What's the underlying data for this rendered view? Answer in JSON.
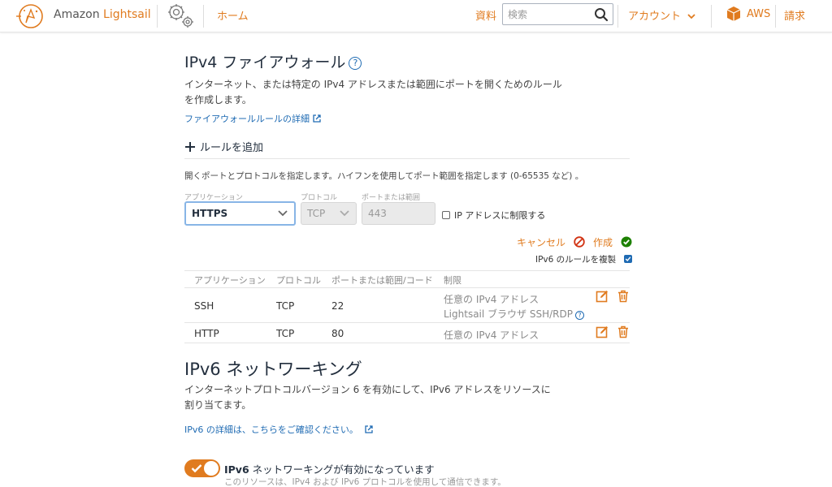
{
  "header": {
    "brand_prefix": "Amazon",
    "brand_name": "Lightsail",
    "home": "ホーム",
    "docs": "資料",
    "search_placeholder": "検索",
    "account": "アカウント",
    "aws": "AWS",
    "billing": "請求"
  },
  "ipv4": {
    "title": "IPv4 ファイアウォール",
    "help": "?",
    "description": "インターネット、または特定の IPv4 アドレスまたは範囲にポートを開くためのルールを作成します。",
    "learn_more": "ファイアウォールルールの詳細",
    "add_rule": "ルールを追加",
    "instructions": "開くポートとプロトコルを指定します。ハイフンを使用してポート範囲を指定します (0-65535 など) 。",
    "form": {
      "application_label": "アプリケーション",
      "application_value": "HTTPS",
      "protocol_label": "プロトコル",
      "protocol_value": "TCP",
      "port_label": "ポートまたは範囲",
      "port_value": "443",
      "restrict_ip": "IP アドレスに制限する",
      "cancel": "キャンセル",
      "create": "作成",
      "duplicate_ipv6": "IPv6 のルールを複製"
    },
    "table": {
      "headers": [
        "アプリケーション",
        "プロトコル",
        "ポートまたは範囲/コード",
        "制限"
      ],
      "rows": [
        {
          "app": "SSH",
          "protocol": "TCP",
          "port": "22",
          "restriction": "任意の IPv4 アドレス",
          "restriction2": "Lightsail ブラウザ SSH/RDP"
        },
        {
          "app": "HTTP",
          "protocol": "TCP",
          "port": "80",
          "restriction": "任意の IPv4 アドレス"
        }
      ]
    }
  },
  "ipv6": {
    "title": "IPv6 ネットワーキング",
    "description": "インターネットプロトコルバージョン 6 を有効にして、IPv6 アドレスをリソースに割り当てます。",
    "learn_more": "IPv6 の詳細は、こちらをご確認ください。",
    "toggle_bold": "IPv6",
    "toggle_label": " ネットワーキングが有効になっています",
    "toggle_sub": "このリソースは、IPv4 および IPv6 プロトコルを使用して通信できます。",
    "enabled": true
  },
  "colors": {
    "accent": "#e07b1f",
    "link": "#1f6bb3",
    "danger": "#d13212",
    "success": "#1d8102"
  }
}
